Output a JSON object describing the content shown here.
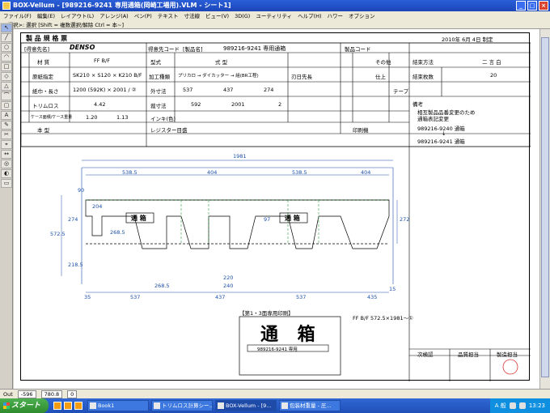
{
  "window": {
    "title": "BOX-Vellum - [989216-9241 専用通箱(岡崎工場用).VLM - シート1]",
    "buttons": [
      "_",
      "□",
      "×"
    ]
  },
  "menu": [
    "ファイル(F)",
    "編集(E)",
    "レイアウト(L)",
    "アレンジ(A)",
    "ペン(P)",
    "テキスト",
    "寸法線",
    "ビュー(V)",
    "3D(G)",
    "ユーティリティ",
    "ヘルプ(H)",
    "ハワー",
    "オプション"
  ],
  "status_line": "<選択>: 選択 [Shift = 複数選択/解除 Ctrl = 本~]",
  "tools": [
    "↖",
    "╱",
    "○",
    "◠",
    "□",
    "◇",
    "△",
    "⌒",
    "▢",
    "A",
    "✎",
    "✂",
    "⌖",
    "↔",
    "◎",
    "◐",
    "▭"
  ],
  "sheet": {
    "title": "製 品 規 格 票",
    "date": "2010年 6月 4日 制定",
    "customer_label": "[得意先名]",
    "customer": "DENSO",
    "customer_code_label": "得意先コード",
    "product_name_label": "[製品名]",
    "product_name": "989216-9241 専用通箱",
    "product_code_label": "製品コード",
    "material_label": "材 質",
    "material": "FF B/F",
    "type_label": "型式",
    "type_value": "式 型",
    "board_spec_label": "原紙指定",
    "board_spec": "SK210 × S120 × K210 B/F",
    "process_label": "加工種類",
    "process": "プリカロ → ダイカッター → 組(BR工程)",
    "cut_label": "紙巾・長さ",
    "cut_value": "1200 (592K) × 2001 / ②",
    "outer_label": "外寸法",
    "outer": [
      "537",
      "437",
      "274"
    ],
    "ready_label": "刃日先長",
    "trim_label": "トリムロス",
    "trim_value": "4.42",
    "area_label": "ケース面積/ケース重量",
    "area": "1.20",
    "weight": "1.13",
    "cut_size_label": "裁寸法",
    "cut_size": [
      "592",
      "2001"
    ],
    "cut_count": "2",
    "ink_label": "インキ(色)",
    "plate_label": "本 型",
    "register_label": "レジスター目盛",
    "stamp_label": "印刷機",
    "other_label": "その他",
    "finish_label": "仕上",
    "packing_label": "結束方法",
    "packing": "二 言 白",
    "bundle_label": "結束枚数",
    "bundle": "20",
    "tape_label": "テープ",
    "notes_title": "備考",
    "notes": [
      "相互製品品番変更のため",
      "通箱表記変更",
      "989216-9240 通箱",
      "↓",
      "989216-9241 通箱"
    ],
    "print_note": "【第1・3面専用印刷】",
    "material_note": "FF B/F 572.5×1981～①",
    "big_label": "通 箱",
    "part_label": "989216-9241 専用",
    "approval": [
      "次検認",
      "品質担当",
      "製造担当"
    ],
    "dimensions": {
      "total": "1981",
      "panels": [
        "538.5",
        "404",
        "538.5",
        "404"
      ],
      "height": "572.5",
      "side": [
        "274",
        "272"
      ],
      "flap": "218.5",
      "bottom": [
        "537",
        "437",
        "537",
        "435"
      ],
      "misc": [
        "204",
        "268.5",
        "240",
        "220",
        "268.5",
        "97",
        "90",
        "35",
        "15"
      ]
    }
  },
  "coords": {
    "label": "Out",
    "x": "-596",
    "y": "780.8",
    "z": "0"
  },
  "taskbar": {
    "start": "スタート",
    "tasks": [
      "Book1",
      "トリムロス計算シー...",
      "BOX-Vellum - [9...",
      "包装材重量 - 圧..."
    ],
    "time": "13:23",
    "ime": "A 般"
  }
}
